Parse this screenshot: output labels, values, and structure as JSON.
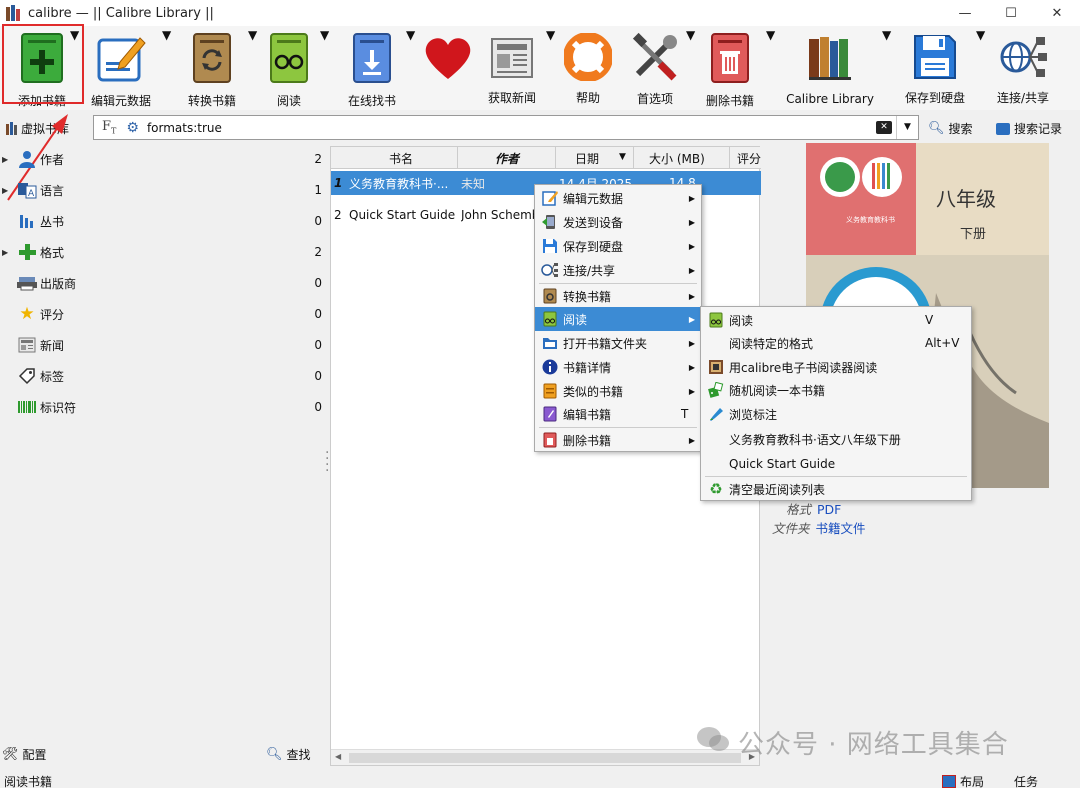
{
  "window": {
    "title": "calibre — || Calibre Library ||"
  },
  "toolbar": [
    {
      "label": "添加书籍",
      "icon": "add-book-icon"
    },
    {
      "label": "编辑元数据",
      "icon": "edit-metadata-icon"
    },
    {
      "label": "转换书籍",
      "icon": "convert-book-icon"
    },
    {
      "label": "阅读",
      "icon": "read-book-icon"
    },
    {
      "label": "在线找书",
      "icon": "download-icon"
    },
    {
      "label": "",
      "icon": "heart-icon"
    },
    {
      "label": "获取新闻",
      "icon": "news-icon"
    },
    {
      "label": "帮助",
      "icon": "help-lifebuoy-icon"
    },
    {
      "label": "首选项",
      "icon": "preferences-tools-icon"
    },
    {
      "label": "删除书籍",
      "icon": "delete-book-icon"
    },
    {
      "label": "Calibre Library",
      "icon": "library-books-icon"
    },
    {
      "label": "保存到硬盘",
      "icon": "save-disk-icon"
    },
    {
      "label": "连接/共享",
      "icon": "connect-share-icon"
    }
  ],
  "search": {
    "virtual_library": "虚拟书库",
    "query": "formats:true",
    "search_button": "搜索",
    "saved_search_button": "搜索记录"
  },
  "tag_browser": [
    {
      "label": "作者",
      "count": "2",
      "icon": "person-icon",
      "expandable": true
    },
    {
      "label": "语言",
      "count": "1",
      "icon": "language-icon",
      "expandable": true
    },
    {
      "label": "丛书",
      "count": "0",
      "icon": "series-icon",
      "expandable": false
    },
    {
      "label": "格式",
      "count": "2",
      "icon": "plus-format-icon",
      "expandable": true
    },
    {
      "label": "出版商",
      "count": "0",
      "icon": "publisher-icon",
      "expandable": false
    },
    {
      "label": "评分",
      "count": "0",
      "icon": "star-icon",
      "expandable": false
    },
    {
      "label": "新闻",
      "count": "0",
      "icon": "news-icon",
      "expandable": false
    },
    {
      "label": "标签",
      "count": "0",
      "icon": "tag-icon",
      "expandable": false
    },
    {
      "label": "标识符",
      "count": "0",
      "icon": "barcode-icon",
      "expandable": false
    }
  ],
  "book_list": {
    "columns": [
      "书名",
      "作者",
      "日期",
      "大小 (MB)",
      "评分"
    ],
    "rows": [
      {
        "num": "1",
        "title": "义务教育教科书·...",
        "author": "未知",
        "date": "14 4月 2025",
        "size": "14.8"
      },
      {
        "num": "2",
        "title": "Quick Start Guide",
        "author": "John Schember",
        "date": "",
        "size": ""
      }
    ]
  },
  "book_details": {
    "cover_title": "八年级",
    "cover_subtitle": "下册",
    "cover_publisher": "义务教育教科书",
    "formats_label": "格式",
    "formats_value": "PDF",
    "folder_label": "文件夹",
    "folder_value": "书籍文件"
  },
  "context_menu": [
    {
      "label": "编辑元数据",
      "icon": "edit-metadata-icon",
      "submenu": true
    },
    {
      "label": "发送到设备",
      "icon": "send-device-icon",
      "submenu": true
    },
    {
      "label": "保存到硬盘",
      "icon": "save-disk-icon",
      "submenu": true
    },
    {
      "label": "连接/共享",
      "icon": "connect-share-icon",
      "submenu": true
    },
    {
      "label": "转换书籍",
      "icon": "convert-book-icon",
      "submenu": true
    },
    {
      "label": "阅读",
      "icon": "read-book-icon",
      "submenu": true,
      "active": true
    },
    {
      "label": "打开书籍文件夹",
      "icon": "folder-icon",
      "submenu": true
    },
    {
      "label": "书籍详情",
      "icon": "info-icon",
      "submenu": true
    },
    {
      "label": "类似的书籍",
      "icon": "similar-books-icon",
      "submenu": true
    },
    {
      "label": "编辑书籍",
      "icon": "edit-book-icon",
      "shortcut": "T"
    },
    {
      "label": "删除书籍",
      "icon": "delete-book-icon",
      "submenu": true
    }
  ],
  "read_submenu": [
    {
      "label": "阅读",
      "icon": "read-book-icon",
      "shortcut": "V"
    },
    {
      "label": "阅读特定的格式",
      "icon": "",
      "shortcut": "Alt+V"
    },
    {
      "label": "用calibre电子书阅读器阅读",
      "icon": "viewer-icon",
      "shortcut": ""
    },
    {
      "label": "随机阅读一本书籍",
      "icon": "random-icon",
      "shortcut": ""
    },
    {
      "label": "浏览标注",
      "icon": "highlighter-icon",
      "shortcut": ""
    },
    {
      "label": "义务教育教科书·语文八年级下册",
      "icon": "",
      "shortcut": ""
    },
    {
      "label": "Quick Start Guide",
      "icon": "",
      "shortcut": ""
    },
    {
      "label": "清空最近阅读列表",
      "icon": "recycle-icon",
      "shortcut": ""
    }
  ],
  "bottom": {
    "config": "配置",
    "find": "查找",
    "status": "阅读书籍",
    "layout": "布局",
    "jobs": "任务"
  },
  "watermark": "公众号 · 网络工具集合",
  "colors": {
    "selection": "#3c8bd4",
    "highlight_box": "#e02b2b",
    "link": "#1a4fbf"
  }
}
